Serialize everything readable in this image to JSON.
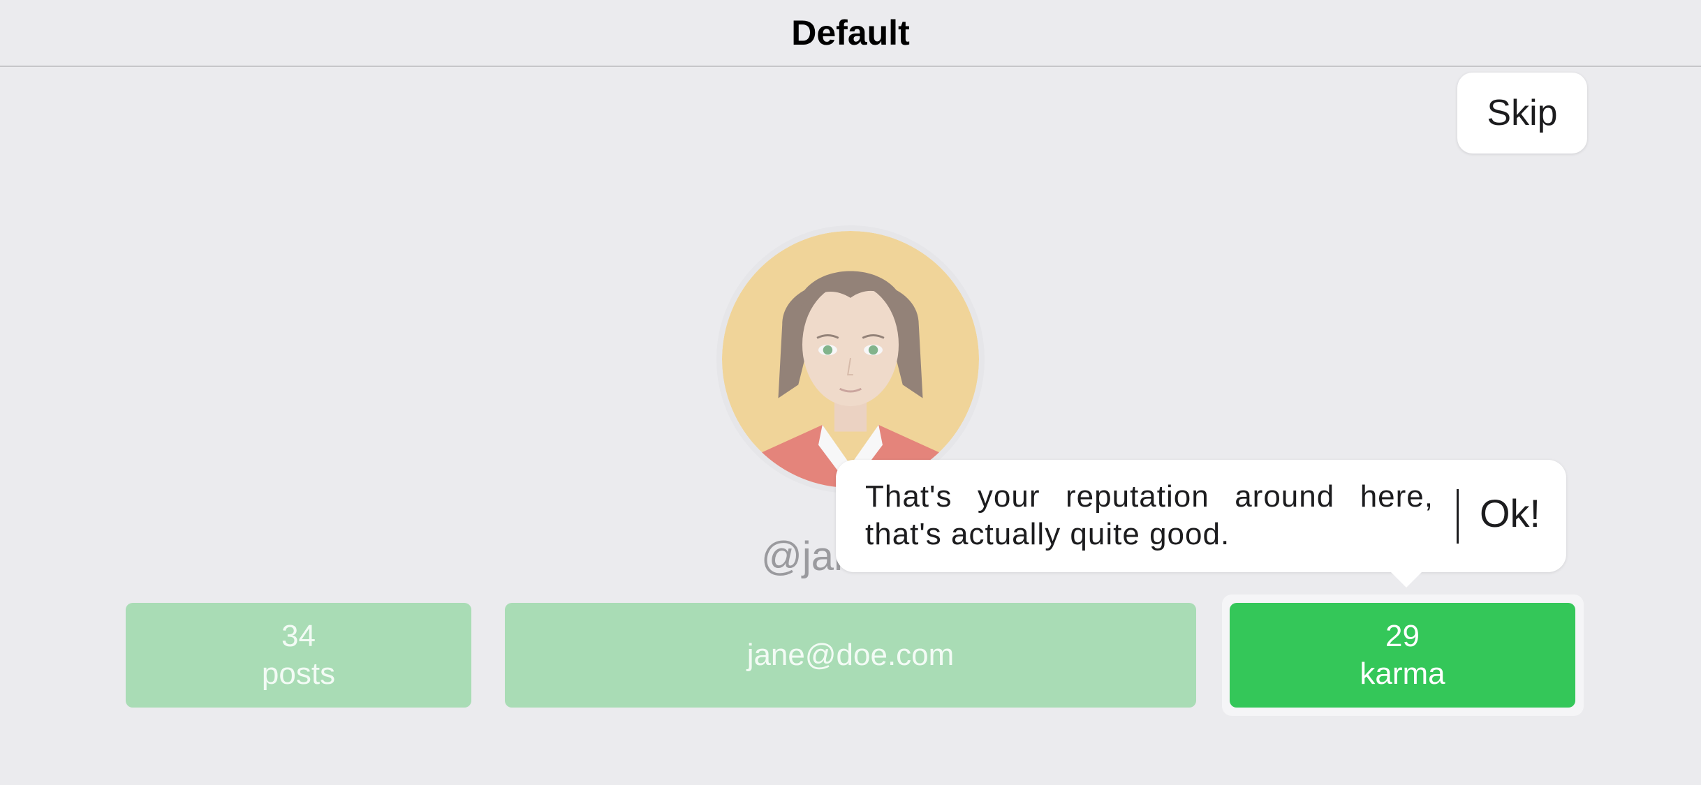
{
  "navbar": {
    "title": "Default"
  },
  "skip_button": {
    "label": "Skip"
  },
  "profile": {
    "username": "@jane",
    "stats": {
      "posts": {
        "value": "34",
        "label": "posts"
      },
      "email": "jane@doe.com",
      "karma": {
        "value": "29",
        "label": "karma"
      }
    }
  },
  "tooltip": {
    "text": "That's your reputation around here, that's actually quite good.",
    "ok_label": "Ok!"
  },
  "colors": {
    "background": "#ebebee",
    "accent_green": "#34c759",
    "dimmed_green": "#a9dcb5",
    "tooltip_bg": "#ffffff"
  },
  "icons": {
    "avatar": "avatar-illustration"
  }
}
